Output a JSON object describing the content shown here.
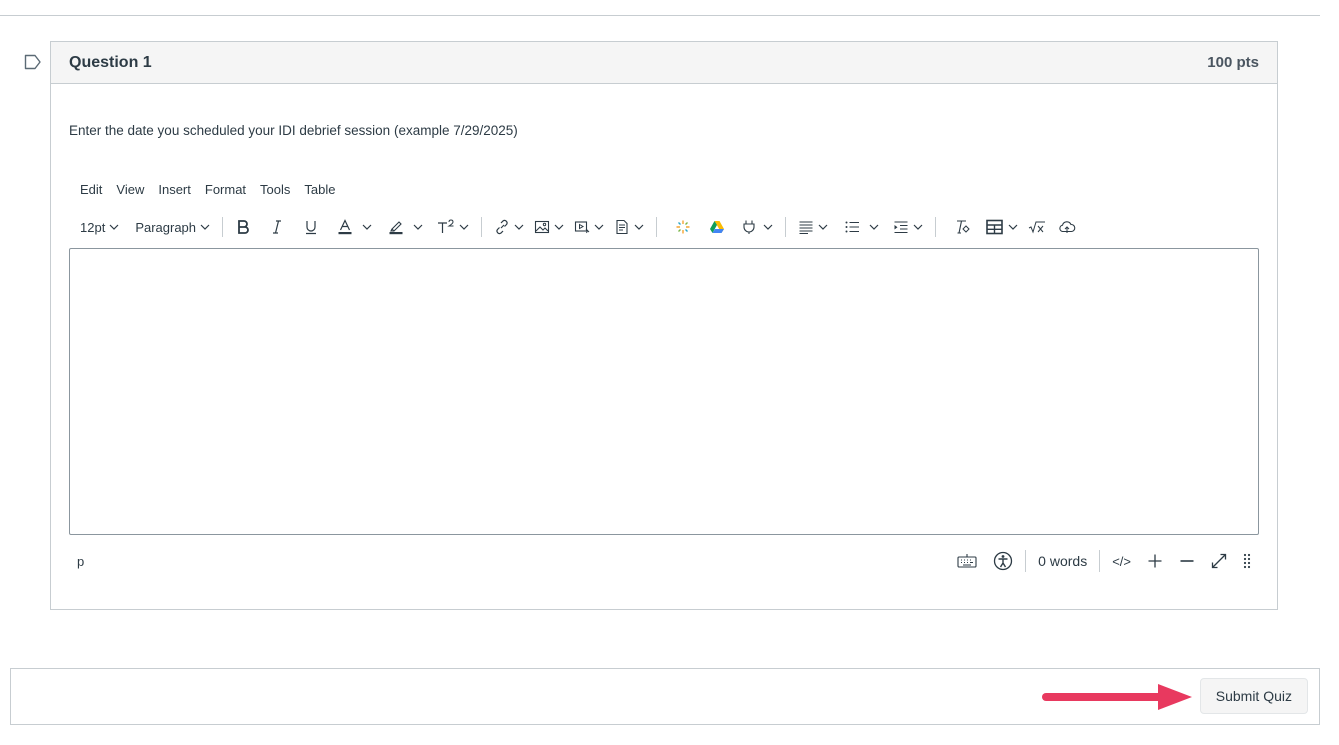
{
  "question": {
    "title": "Question 1",
    "points": "100 pts",
    "text": "Enter the date you scheduled your IDI debrief session (example 7/29/2025)"
  },
  "editor": {
    "menu": [
      "Edit",
      "View",
      "Insert",
      "Format",
      "Tools",
      "Table"
    ],
    "font_size": "12pt",
    "block_format": "Paragraph",
    "content": "",
    "status_path": "p",
    "word_count": "0 words",
    "html_editor_label": "</>"
  },
  "footer": {
    "submit_label": "Submit Quiz"
  },
  "colors": {
    "arrow": "#e8395f",
    "text": "#2d3b45",
    "border": "#c7cdd1"
  }
}
